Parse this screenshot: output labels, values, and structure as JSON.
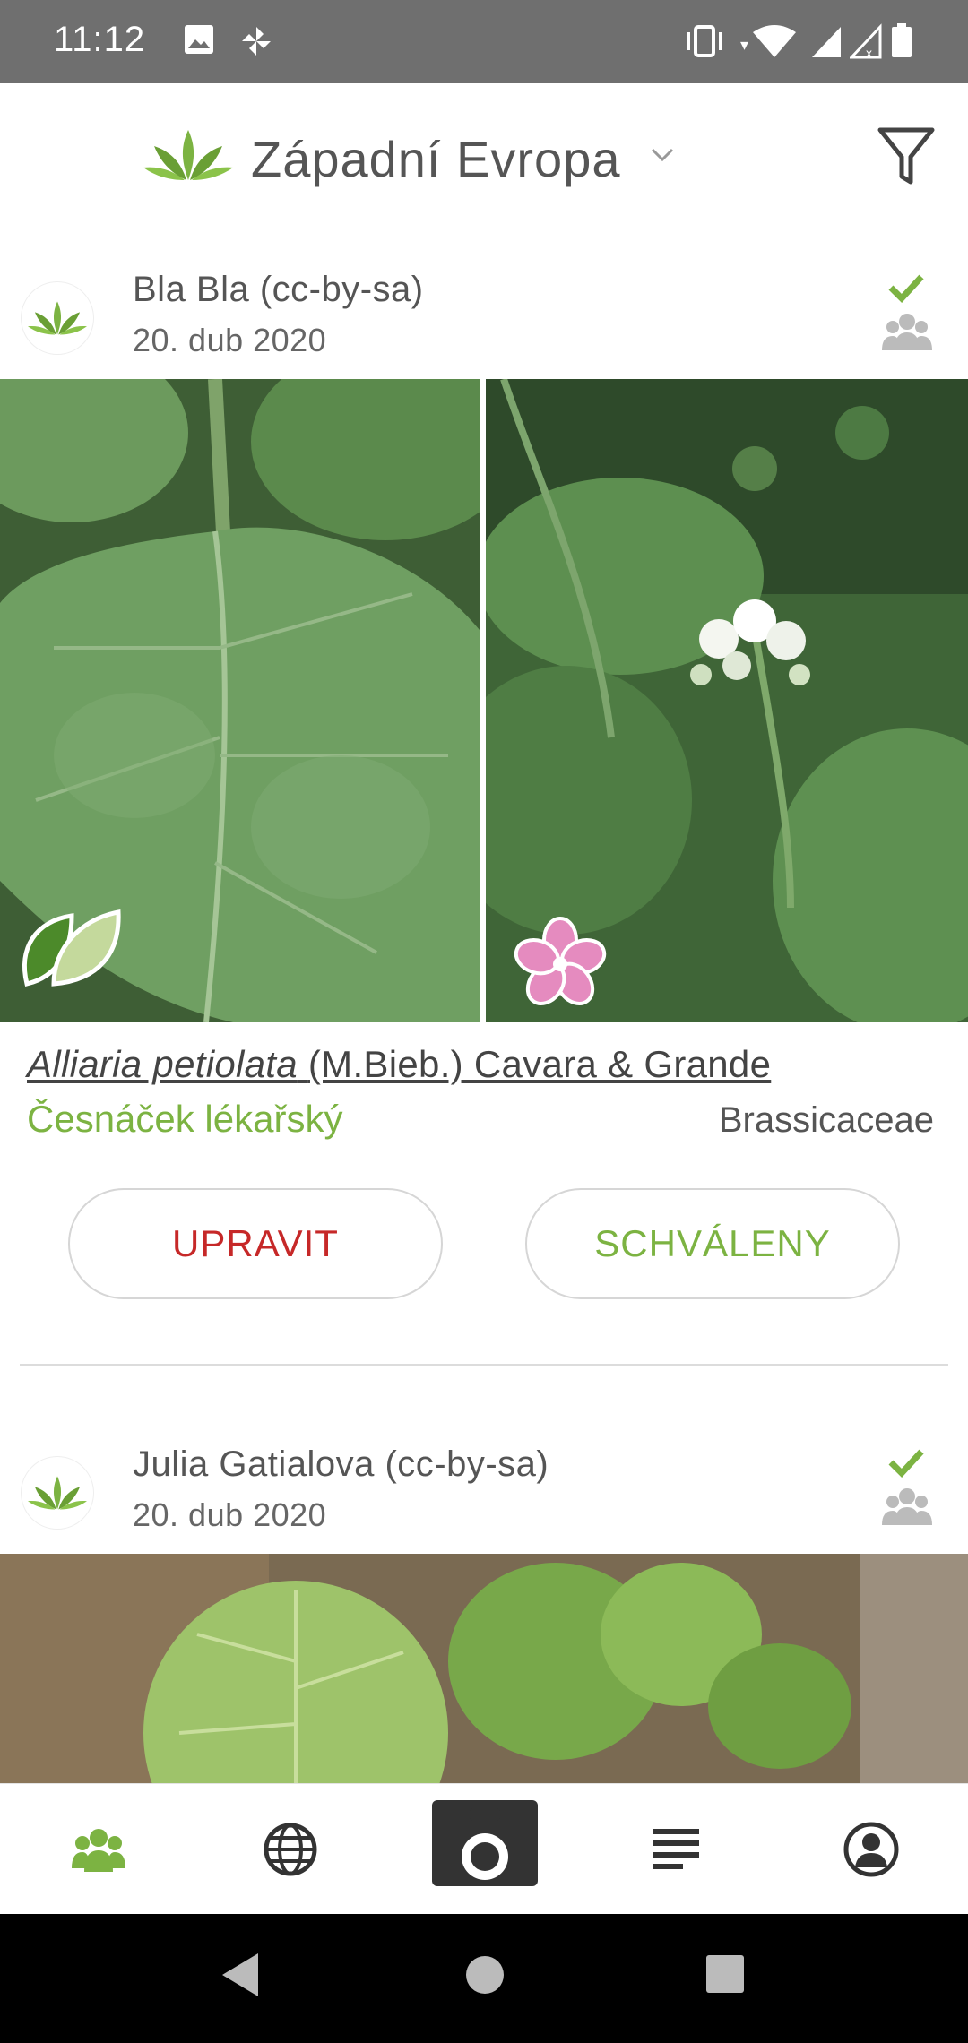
{
  "status_bar": {
    "time": "11:12",
    "icons": [
      "image-icon",
      "pinwheel-icon",
      "vibrate-icon",
      "wifi-icon",
      "signal-icon",
      "signal-x-icon",
      "battery-icon"
    ]
  },
  "header": {
    "region": "Západní Evropa",
    "icons": [
      "plantnet-logo-icon",
      "chevron-down-icon",
      "filter-icon"
    ]
  },
  "cards": [
    {
      "author": "Bla Bla (cc-by-sa)",
      "date": "20. dub 2020",
      "species_latin": "Alliaria petiolata",
      "species_authority": "(M.Bieb.) Cavara & Grande",
      "common_name": "Česnáček lékařský",
      "family": "Brassicaceae",
      "photo_organs": [
        "leaf-icon",
        "flower-icon"
      ],
      "buttons": {
        "edit": "UPRAVIT",
        "approved": "SCHVÁLENY"
      }
    },
    {
      "author": "Julia Gatialova (cc-by-sa)",
      "date": "20. dub 2020"
    }
  ],
  "bottom_nav": [
    "community-icon",
    "globe-icon",
    "camera-icon",
    "list-icon",
    "profile-icon"
  ],
  "colors": {
    "accent_green": "#7cb342",
    "edit_red": "#c62828",
    "status_bar": "#6f6f6f"
  }
}
